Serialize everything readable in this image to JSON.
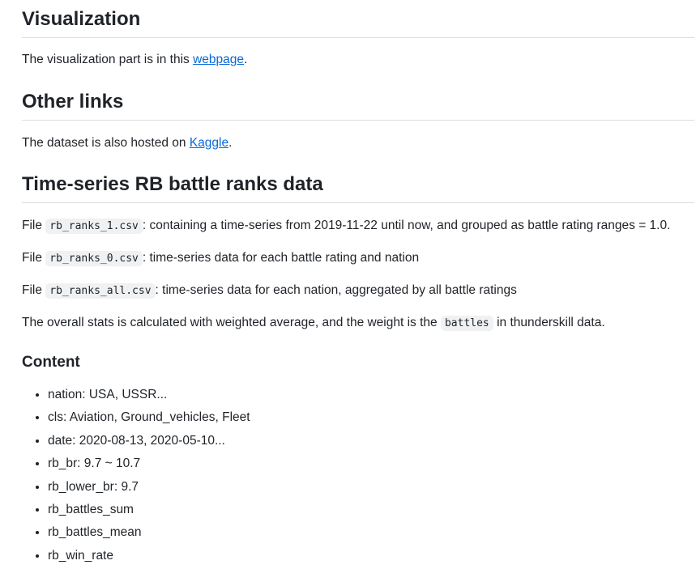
{
  "visualization": {
    "heading": "Visualization",
    "text_before": "The visualization part is in this ",
    "link": "webpage",
    "text_after": "."
  },
  "other_links": {
    "heading": "Other links",
    "text_before": "The dataset is also hosted on ",
    "link": "Kaggle",
    "text_after": "."
  },
  "rb_ranks": {
    "heading": "Time-series RB battle ranks data",
    "files": [
      {
        "prefix": "File ",
        "code": "rb_ranks_1.csv",
        "desc": ": containing a time-series from 2019-11-22 until now, and grouped as battle rating ranges = 1.0."
      },
      {
        "prefix": "File ",
        "code": "rb_ranks_0.csv",
        "desc": ": time-series data for each battle rating and nation"
      },
      {
        "prefix": "File ",
        "code": "rb_ranks_all.csv",
        "desc": ": time-series data for each nation, aggregated by all battle ratings"
      }
    ],
    "overall_before": "The overall stats is calculated with weighted average, and the weight is the ",
    "overall_code": "battles",
    "overall_after": " in thunderskill data."
  },
  "content": {
    "heading": "Content",
    "items": [
      "nation: USA, USSR...",
      "cls: Aviation, Ground_vehicles, Fleet",
      "date: 2020-08-13, 2020-05-10...",
      "rb_br: 9.7 ~ 10.7",
      "rb_lower_br: 9.7",
      "rb_battles_sum",
      "rb_battles_mean",
      "rb_win_rate"
    ]
  }
}
